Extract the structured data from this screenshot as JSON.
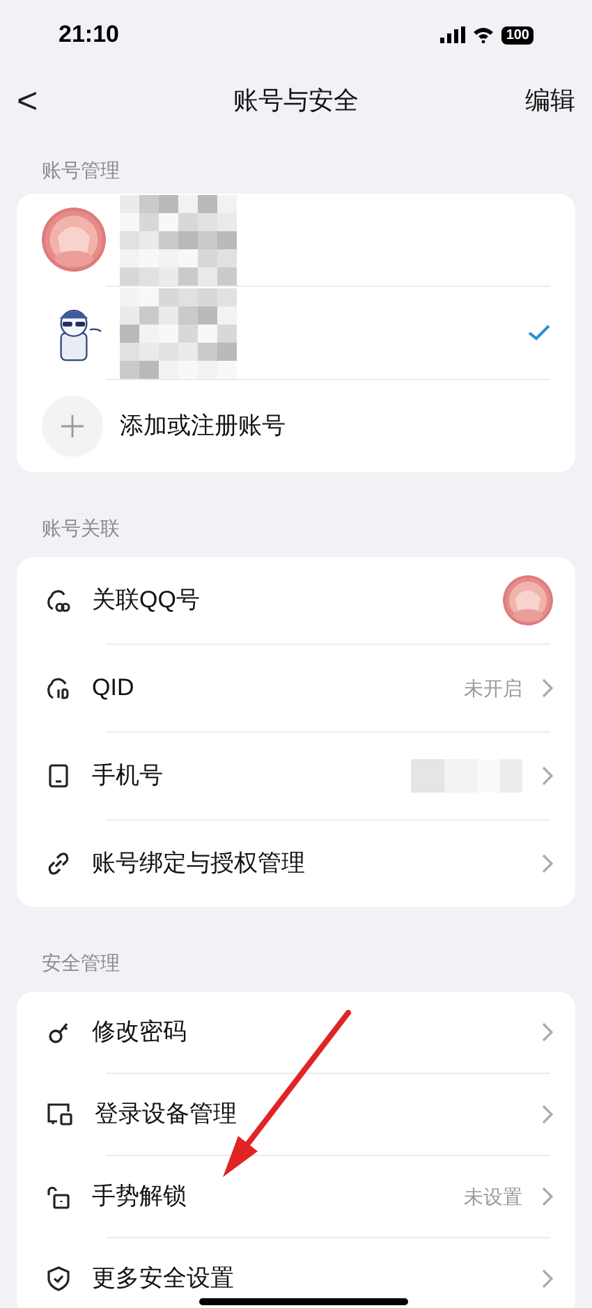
{
  "status_bar": {
    "time": "21:10",
    "battery": "100"
  },
  "nav": {
    "back": "<",
    "title": "账号与安全",
    "action": "编辑"
  },
  "sections": [
    {
      "title": "账号管理",
      "kind": "accounts",
      "items": [
        {
          "kind": "account",
          "selected": false
        },
        {
          "kind": "account",
          "selected": true
        },
        {
          "kind": "add",
          "label": "添加或注册账号"
        }
      ]
    },
    {
      "title": "账号关联",
      "kind": "settings",
      "items": [
        {
          "kind": "qq",
          "label": "关联QQ号"
        },
        {
          "kind": "qid",
          "label": "QID",
          "value": "未开启"
        },
        {
          "kind": "phone",
          "label": "手机号"
        },
        {
          "kind": "link",
          "label": "账号绑定与授权管理"
        }
      ]
    },
    {
      "title": "安全管理",
      "kind": "settings",
      "items": [
        {
          "kind": "key",
          "label": "修改密码"
        },
        {
          "kind": "devices",
          "label": "登录设备管理"
        },
        {
          "kind": "lock",
          "label": "手势解锁",
          "value": "未设置"
        },
        {
          "kind": "shield",
          "label": "更多安全设置"
        }
      ]
    }
  ]
}
